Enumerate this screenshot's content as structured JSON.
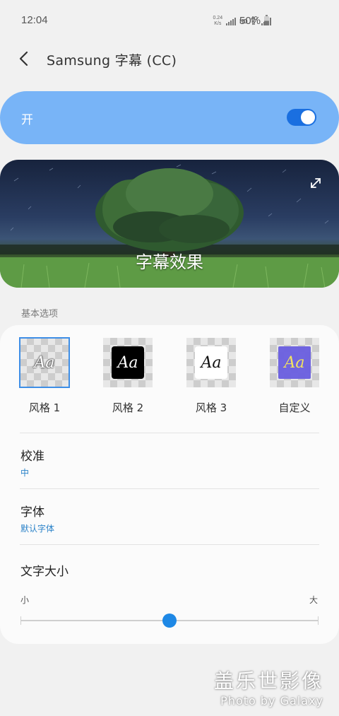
{
  "status_bar": {
    "time": "12:04",
    "net_speed_value": "0.24",
    "net_speed_unit": "K/s",
    "hd": "HD",
    "network": "4G",
    "battery": "50%"
  },
  "header": {
    "back_icon": "chevron-left-icon",
    "title": "Samsung 字幕 (CC)"
  },
  "master_switch": {
    "label": "开",
    "on": true,
    "accent": "#78b4f7",
    "toggle_color": "#1a6fe0"
  },
  "preview": {
    "caption": "字幕效果",
    "expand_icon": "expand-icon"
  },
  "basic_options": {
    "section_label": "基本选项",
    "styles": [
      {
        "label": "风格 1",
        "sample": "Aa",
        "selected": true
      },
      {
        "label": "风格 2",
        "sample": "Aa",
        "selected": false
      },
      {
        "label": "风格 3",
        "sample": "Aa",
        "selected": false
      },
      {
        "label": "自定义",
        "sample": "Aa",
        "selected": false
      }
    ],
    "alignment": {
      "title": "校准",
      "value": "中"
    },
    "font": {
      "title": "字体",
      "value": "默认字体"
    },
    "text_size": {
      "title": "文字大小",
      "min_label": "小",
      "max_label": "大",
      "level": 0.5
    }
  },
  "watermark": {
    "line1": "盖乐世影像",
    "line2": "Photo by Galaxy"
  }
}
